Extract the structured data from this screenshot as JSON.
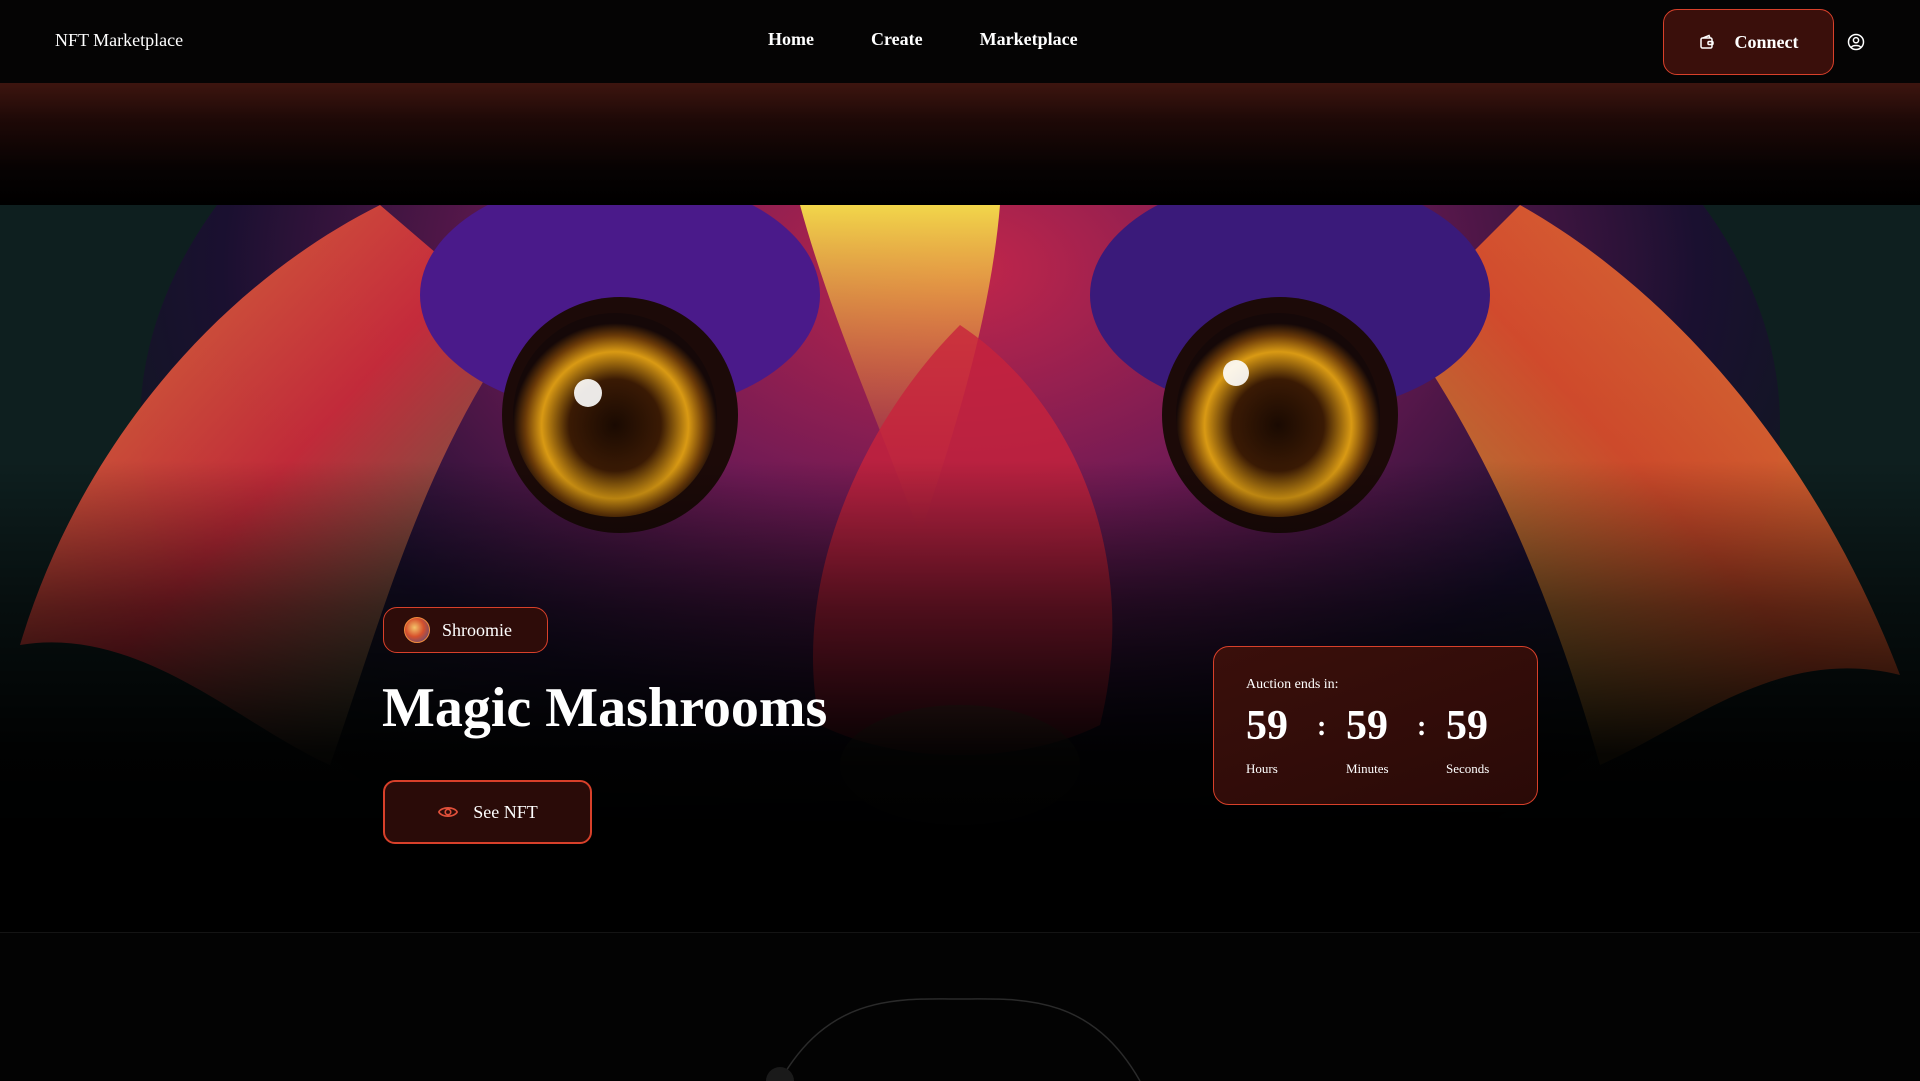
{
  "nav": {
    "brand": "NFT Marketplace",
    "links": [
      "Home",
      "Create",
      "Marketplace"
    ],
    "connect_label": "Connect",
    "connect_icon": "wallet-icon",
    "profile_icon": "user-circle-icon"
  },
  "hero": {
    "creator": "Shroomie",
    "title": "Magic Mashrooms",
    "see_button_label": "See NFT",
    "see_button_icon": "eye-icon"
  },
  "auction": {
    "label": "Auction ends in:",
    "hours": "59",
    "minutes": "59",
    "seconds": "59",
    "hours_label": "Hours",
    "minutes_label": "Minutes",
    "seconds_label": "Seconds",
    "separator": ":"
  },
  "colors": {
    "accent": "#d8402a",
    "button_bg": "#3a0f0b",
    "background": "#000000"
  }
}
